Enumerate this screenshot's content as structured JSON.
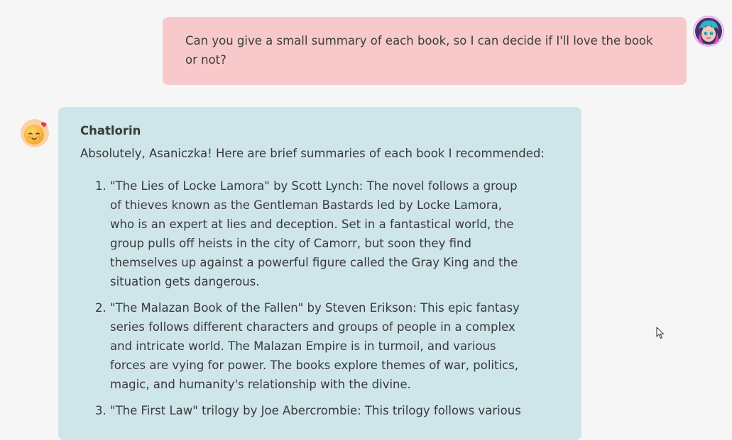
{
  "user_message": {
    "text": "Can you give a small summary of each book, so I can decide if I'll love the book or not?"
  },
  "bot_message": {
    "name": "Chatlorin",
    "intro": "Absolutely, Asaniczka! Here are brief summaries of each book I recommended:",
    "items": [
      "\"The Lies of Locke Lamora\" by Scott Lynch: The novel follows a group of thieves known as the Gentleman Bastards led by Locke Lamora, who is an expert at lies and deception. Set in a fantastical world, the group pulls off heists in the city of Camorr, but soon they find themselves up against a powerful figure called the Gray King and the situation gets dangerous.",
      "\"The Malazan Book of the Fallen\" by Steven Erikson: This epic fantasy series follows different characters and groups of people in a complex and intricate world. The Malazan Empire is in turmoil, and various forces are vying for power. The books explore themes of war, politics, magic, and humanity's relationship with the divine.",
      "\"The First Law\" trilogy by Joe Abercrombie: This trilogy follows various"
    ]
  },
  "colors": {
    "background": "#f6f6f6",
    "user_bubble": "#f7c9cb",
    "bot_bubble": "#cee5ea",
    "text": "#3a3a3a"
  },
  "icons": {
    "user_avatar": "user-avatar-icon",
    "bot_avatar": "smiling-face-with-hearts-icon",
    "cursor": "mouse-cursor-icon"
  }
}
